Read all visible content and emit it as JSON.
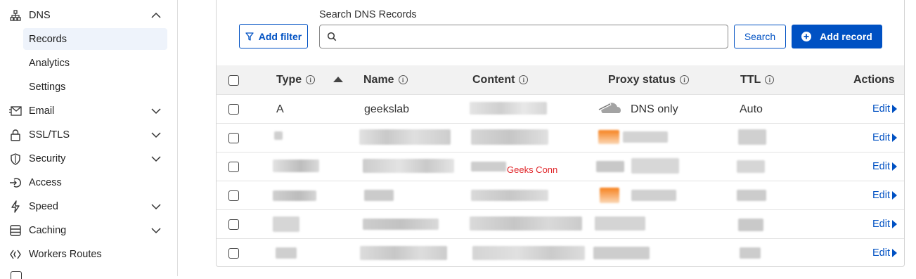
{
  "sidebar": {
    "dns": "DNS",
    "dns_children": [
      "Records",
      "Analytics",
      "Settings"
    ],
    "items": [
      "Email",
      "SSL/TLS",
      "Security",
      "Access",
      "Speed",
      "Caching",
      "Workers Routes"
    ]
  },
  "toolbar": {
    "filter_label": "Add filter",
    "search_label": "Search DNS Records",
    "search_value": "",
    "search_button": "Search",
    "add_label": "Add record"
  },
  "table": {
    "headers": {
      "type": "Type",
      "name": "Name",
      "content": "Content",
      "proxy": "Proxy status",
      "ttl": "TTL",
      "actions": "Actions"
    },
    "first_row": {
      "type": "A",
      "name": "geekslab",
      "proxy": "DNS only",
      "ttl": "Auto"
    },
    "edit_label": "Edit"
  },
  "watermark": "Geeks Conn",
  "colors": {
    "accent": "#0051c3",
    "proxied": "#f6821f"
  }
}
